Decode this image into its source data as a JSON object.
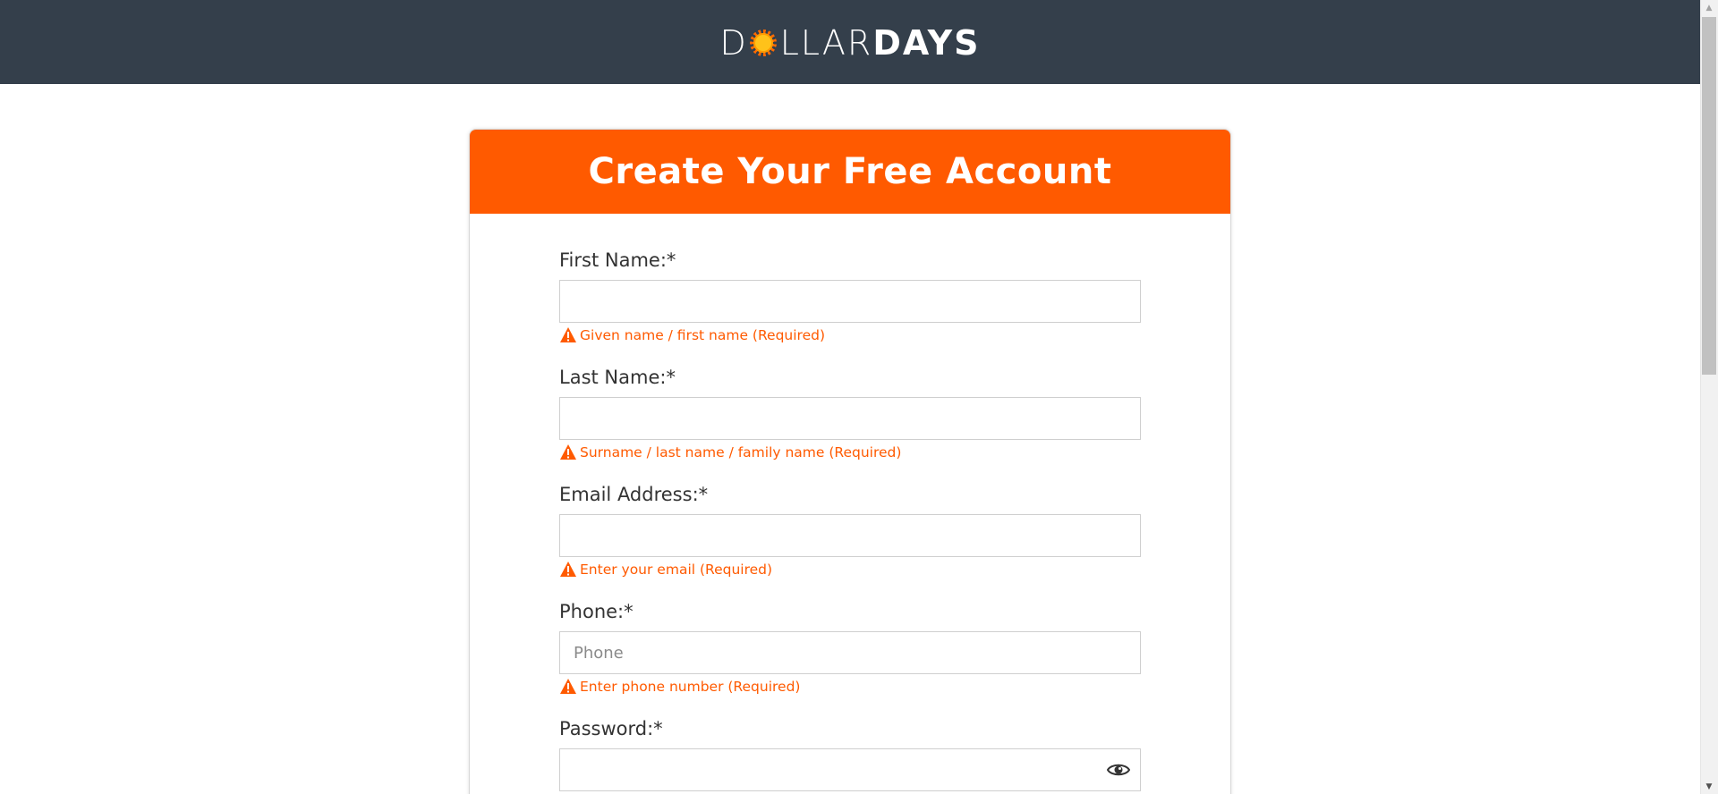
{
  "header": {
    "logo_part1": "D",
    "logo_part2": "LLAR",
    "logo_part3": "DAYS"
  },
  "form": {
    "title": "Create Your Free Account",
    "fields": [
      {
        "label": "First Name:*",
        "placeholder": "",
        "value": "",
        "error": "Given name / first name (Required)"
      },
      {
        "label": "Last Name:*",
        "placeholder": "",
        "value": "",
        "error": "Surname / last name / family name (Required)"
      },
      {
        "label": "Email Address:*",
        "placeholder": "",
        "value": "",
        "error": "Enter your email (Required)"
      },
      {
        "label": "Phone:*",
        "placeholder": "Phone",
        "value": "",
        "error": "Enter phone number (Required)"
      },
      {
        "label": "Password:*",
        "placeholder": "",
        "value": ""
      }
    ]
  },
  "colors": {
    "topbar": "#343f4b",
    "accent": "#ff5a00",
    "sun_core": "#ffc21a"
  },
  "icons": {
    "warning": "warning-triangle-icon",
    "eye": "eye-icon",
    "sun": "sun-logo-icon"
  }
}
